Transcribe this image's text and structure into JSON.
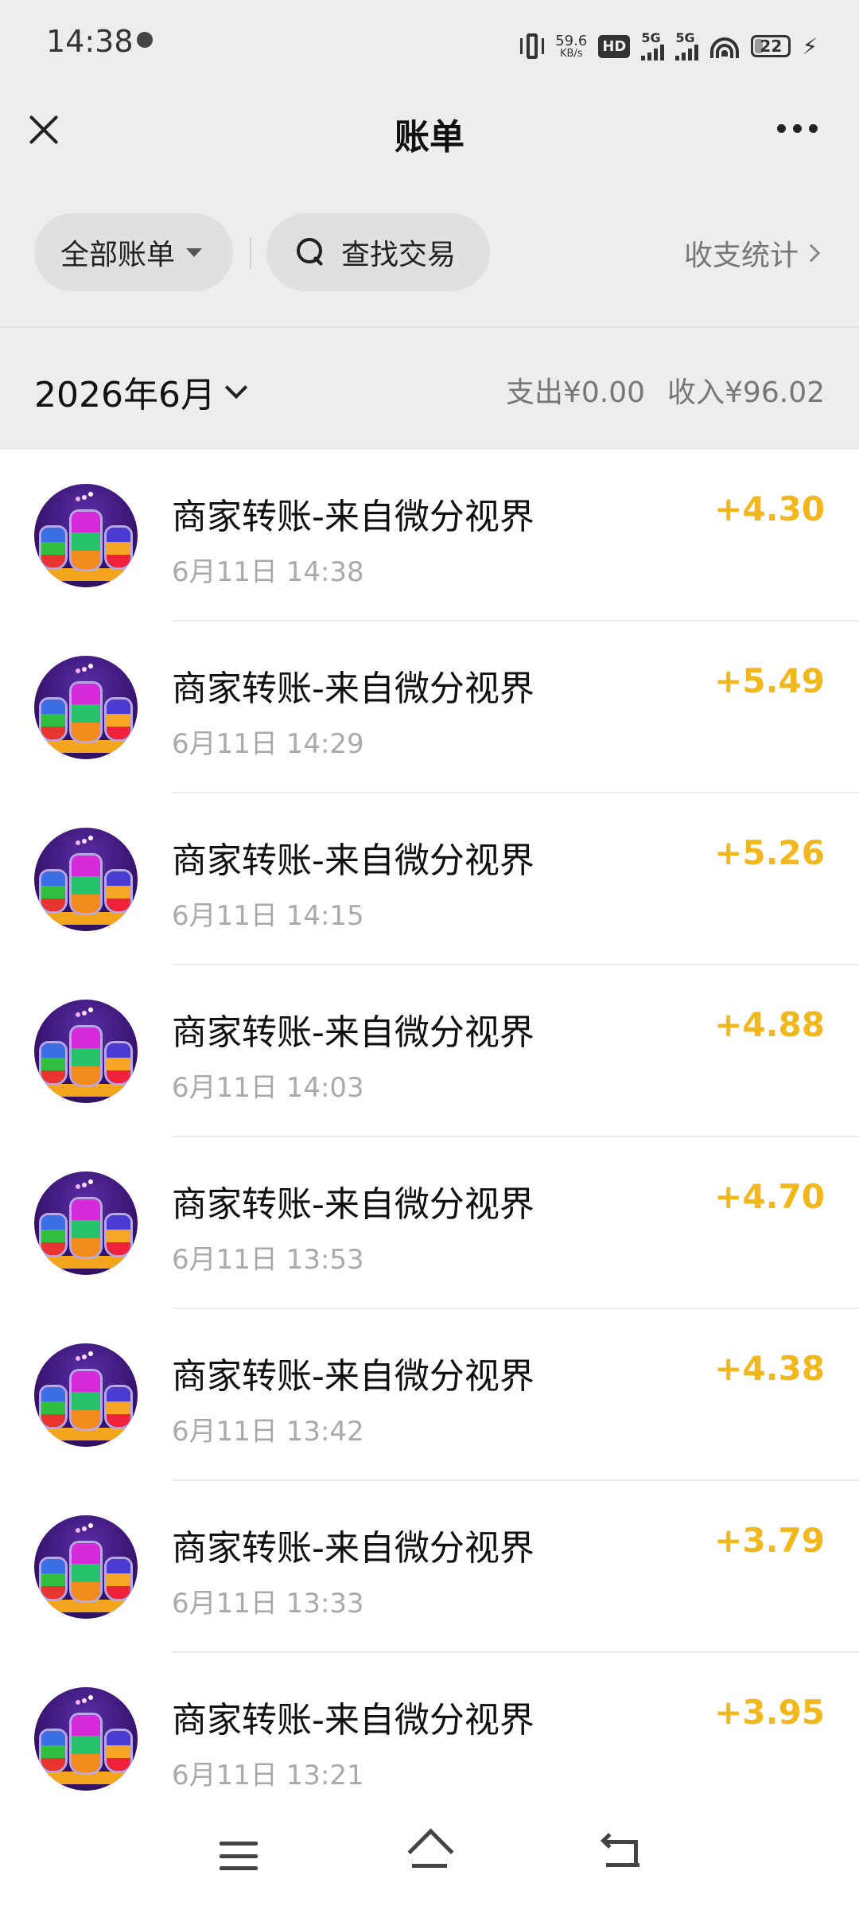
{
  "status_bar": {
    "time": "14:38",
    "net_speed_value": "59.6",
    "net_speed_unit": "KB/s",
    "hd_label": "HD",
    "signal_1": "5G",
    "signal_2": "5G",
    "battery": "22",
    "icons": [
      "moon-icon",
      "vibrate-icon",
      "hd-icon",
      "signal-icon",
      "wifi-icon",
      "battery-icon",
      "charging-icon"
    ]
  },
  "nav": {
    "title": "账单",
    "close_icon": "close-icon",
    "more_icon": "more-icon"
  },
  "filters": {
    "all_bills": "全部账单",
    "search": "查找交易",
    "stats": "收支统计"
  },
  "month": {
    "label": "2026年6月",
    "expense": "支出¥0.00",
    "income": "收入¥96.02"
  },
  "transactions": [
    {
      "title": "商家转账-来自微分视界",
      "time": "6月11日 14:38",
      "amount": "+4.30"
    },
    {
      "title": "商家转账-来自微分视界",
      "time": "6月11日 14:29",
      "amount": "+5.49"
    },
    {
      "title": "商家转账-来自微分视界",
      "time": "6月11日 14:15",
      "amount": "+5.26"
    },
    {
      "title": "商家转账-来自微分视界",
      "time": "6月11日 14:03",
      "amount": "+4.88"
    },
    {
      "title": "商家转账-来自微分视界",
      "time": "6月11日 13:53",
      "amount": "+4.70"
    },
    {
      "title": "商家转账-来自微分视界",
      "time": "6月11日 13:42",
      "amount": "+4.38"
    },
    {
      "title": "商家转账-来自微分视界",
      "time": "6月11日 13:33",
      "amount": "+3.79"
    },
    {
      "title": "商家转账-来自微分视界",
      "time": "6月11日 13:21",
      "amount": "+3.95"
    }
  ],
  "bottom_nav": {
    "icons": [
      "menu-icon",
      "home-icon",
      "back-icon"
    ]
  },
  "colors": {
    "header_bg": "#ededed",
    "amount": "#f1b71c",
    "secondary_text": "#aaaaaa"
  }
}
